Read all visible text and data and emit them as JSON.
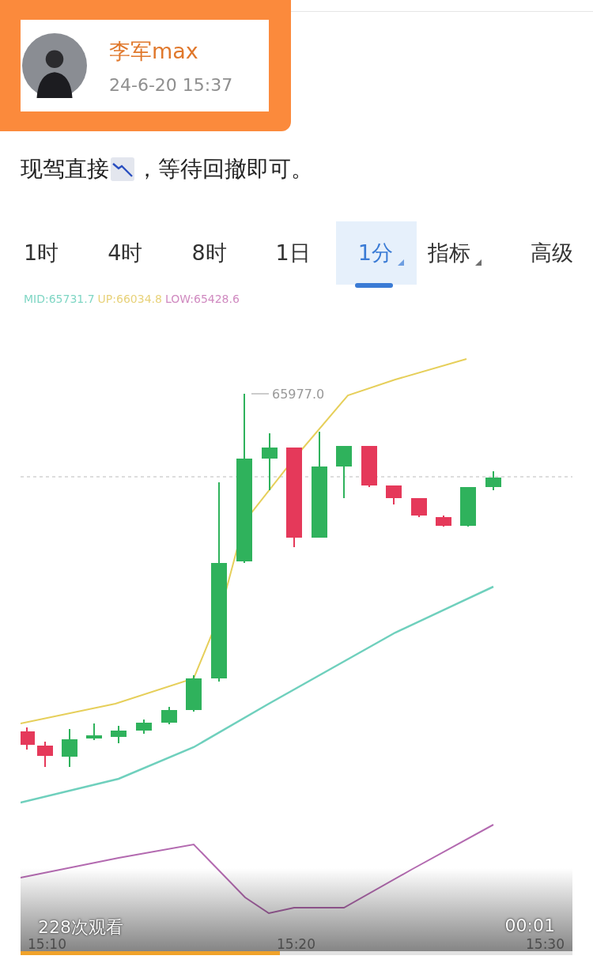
{
  "post": {
    "author": "李军max",
    "time": "24-6-20 15:37",
    "text_before": "现驾直接",
    "text_after": "，等待回撤即可。"
  },
  "video": {
    "tabs": [
      {
        "label": "1时",
        "selected": false,
        "dropdown": false
      },
      {
        "label": "4时",
        "selected": false,
        "dropdown": false
      },
      {
        "label": "8时",
        "selected": false,
        "dropdown": false
      },
      {
        "label": "1日",
        "selected": false,
        "dropdown": false
      },
      {
        "label": "1分",
        "selected": true,
        "dropdown": true
      },
      {
        "label": "指标",
        "selected": false,
        "dropdown": true
      },
      {
        "label": "高级",
        "selected": false,
        "dropdown": false
      }
    ],
    "indicators": [
      {
        "text": "MID:65731.7",
        "color": "#7fd6c4"
      },
      {
        "text": "UP:66034.8",
        "color": "#e8d27a"
      },
      {
        "text": "LOW:65428.6",
        "color": "#d08ac0"
      }
    ],
    "high_label": "65977.0",
    "time_labels": [
      "15:10",
      "15:20",
      "15:30"
    ],
    "views": "228次观看",
    "duration": "00:01",
    "progress": {
      "level": 0.47
    }
  }
}
